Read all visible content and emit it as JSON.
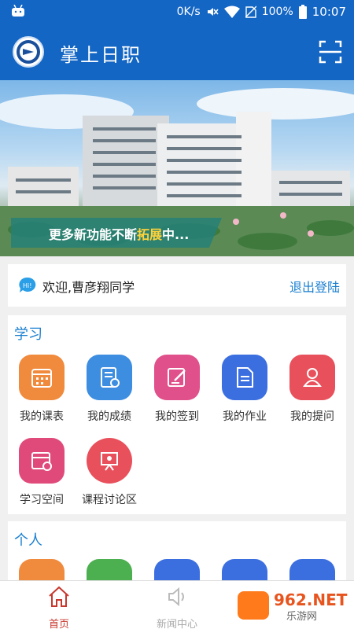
{
  "status_bar": {
    "network_speed": "0K/s",
    "battery": "100%",
    "time": "10:07"
  },
  "header": {
    "title": "掌上日职"
  },
  "banner": {
    "caption_pre": "更多新功能不断",
    "caption_highlight": "拓展",
    "caption_post": "中..."
  },
  "welcome": {
    "greeting": "欢迎,曹彦翔同学",
    "logout_label": "退出登陆"
  },
  "study": {
    "title": "学习",
    "tiles": [
      {
        "label": "我的课表",
        "icon": "calendar-icon",
        "color": "#f08a3c"
      },
      {
        "label": "我的成绩",
        "icon": "report-icon",
        "color": "#3d8de0"
      },
      {
        "label": "我的签到",
        "icon": "sign-in-icon",
        "color": "#e0508a"
      },
      {
        "label": "我的作业",
        "icon": "homework-icon",
        "color": "#3b6fe0"
      },
      {
        "label": "我的提问",
        "icon": "question-icon",
        "color": "#e8505b"
      },
      {
        "label": "学习空间",
        "icon": "study-space-icon",
        "color": "#e04a7a"
      },
      {
        "label": "课程讨论区",
        "icon": "discussion-icon",
        "color": "#e8505b"
      }
    ]
  },
  "personal": {
    "title": "个人",
    "tile_colors": [
      "#f08a3c",
      "#4caf50",
      "#3b6fe0",
      "#3b6fe0",
      "#3b6fe0"
    ]
  },
  "bottom_nav": {
    "items": [
      {
        "label": "首页",
        "icon": "home-icon",
        "active": true
      },
      {
        "label": "新闻中心",
        "icon": "news-speaker-icon",
        "active": false
      }
    ]
  },
  "watermark": {
    "text": "962.NET",
    "subtext": "乐游网"
  }
}
